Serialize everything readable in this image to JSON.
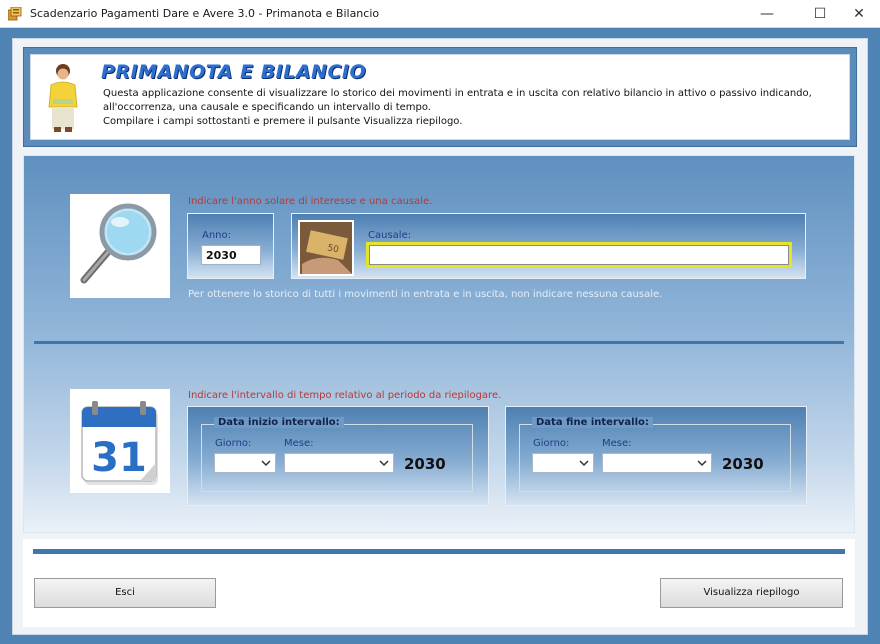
{
  "window": {
    "title": "Scadenzario Pagamenti Dare e Avere 3.0 - Primanota e Bilancio",
    "minimize_glyph": "—",
    "maximize_glyph": "☐",
    "close_glyph": "✕"
  },
  "header": {
    "title": "PRIMANOTA E BILANCIO",
    "description_line1": "Questa applicazione consente di visualizzare lo storico dei movimenti in entrata e in uscita con relativo bilancio in attivo o passivo indicando,",
    "description_line2": "all'occorrenza, una causale e specificando un intervallo di tempo.",
    "description_line3": "Compilare i campi sottostanti e premere il pulsante Visualizza riepilogo."
  },
  "search_section": {
    "instruction": "Indicare l'anno solare di interesse e una causale.",
    "anno_label": "Anno:",
    "anno_value": "2030",
    "causale_label": "Causale:",
    "causale_value": "",
    "hint": "Per ottenere lo storico di tutti i movimenti in entrata e in uscita, non indicare nessuna causale."
  },
  "interval_section": {
    "instruction": "Indicare l'intervallo di tempo relativo al periodo da riepilogare.",
    "calendar_day": "31",
    "start": {
      "title": "Data inizio intervallo:",
      "giorno_label": "Giorno:",
      "mese_label": "Mese:",
      "giorno_value": "",
      "mese_value": "",
      "year": "2030"
    },
    "end": {
      "title": "Data fine intervallo:",
      "giorno_label": "Giorno:",
      "mese_label": "Mese:",
      "giorno_value": "",
      "mese_value": "",
      "year": "2030"
    }
  },
  "buttons": {
    "exit": "Esci",
    "show_summary": "Visualizza riepilogo"
  },
  "colors": {
    "frame": "#4f83b4",
    "title_blue": "#2d6fd1",
    "instruction_red": "#b23a3a",
    "focus_yellow": "#e4e42a"
  }
}
